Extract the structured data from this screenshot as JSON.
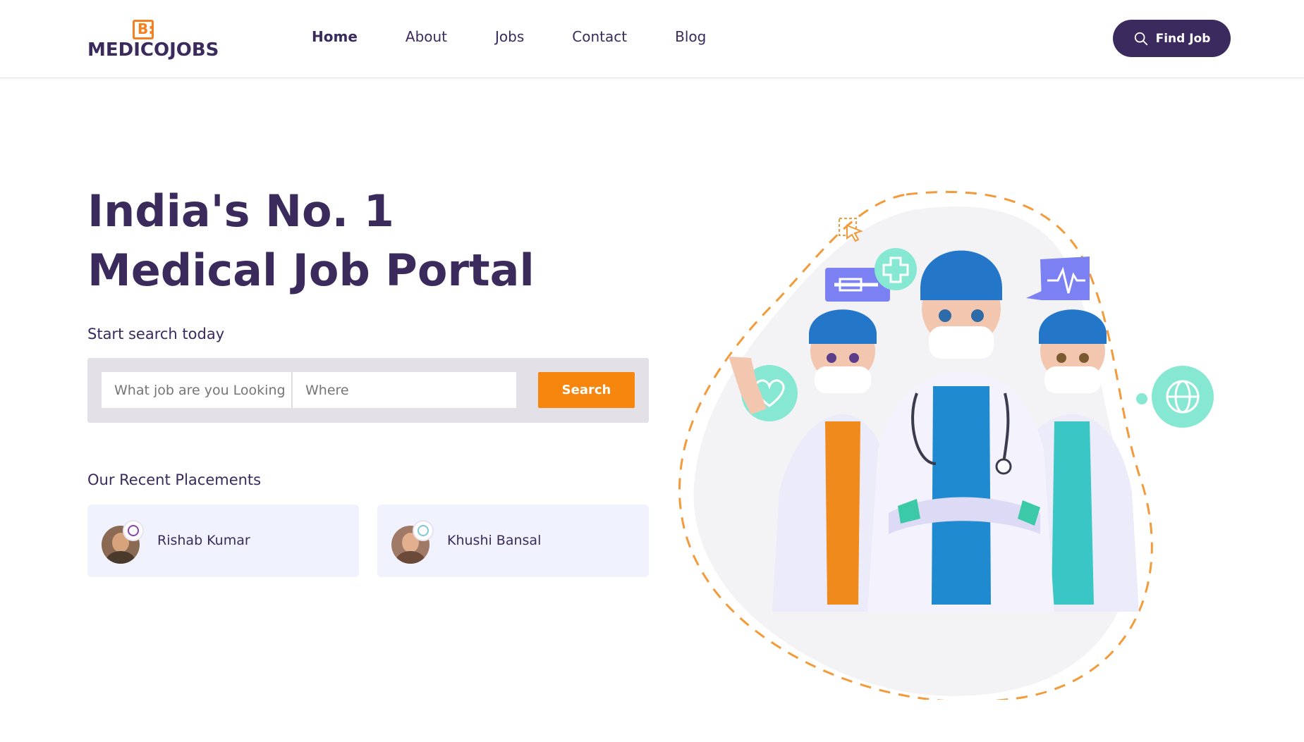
{
  "header": {
    "logo_text": "MEDICOJOBS",
    "logo_mark": "B:",
    "nav": [
      {
        "label": "Home",
        "active": true
      },
      {
        "label": "About",
        "active": false
      },
      {
        "label": "Jobs",
        "active": false
      },
      {
        "label": "Contact",
        "active": false
      },
      {
        "label": "Blog",
        "active": false
      }
    ],
    "find_job_label": "Find Job",
    "find_job_icon": "search-icon"
  },
  "hero": {
    "title_line1": "India's No. 1",
    "title_line2": "Medical Job Portal",
    "subtitle": "Start search today"
  },
  "search": {
    "what_placeholder": "What job are you Looking",
    "where_placeholder": "Where",
    "button_label": "Search"
  },
  "placements": {
    "title": "Our Recent Placements",
    "items": [
      {
        "name": "Rishab Kumar"
      },
      {
        "name": "Khushi Bansal"
      }
    ]
  },
  "colors": {
    "primary": "#3b2a5e",
    "accent": "#f7860f",
    "card_bg": "#f0f2fd"
  }
}
